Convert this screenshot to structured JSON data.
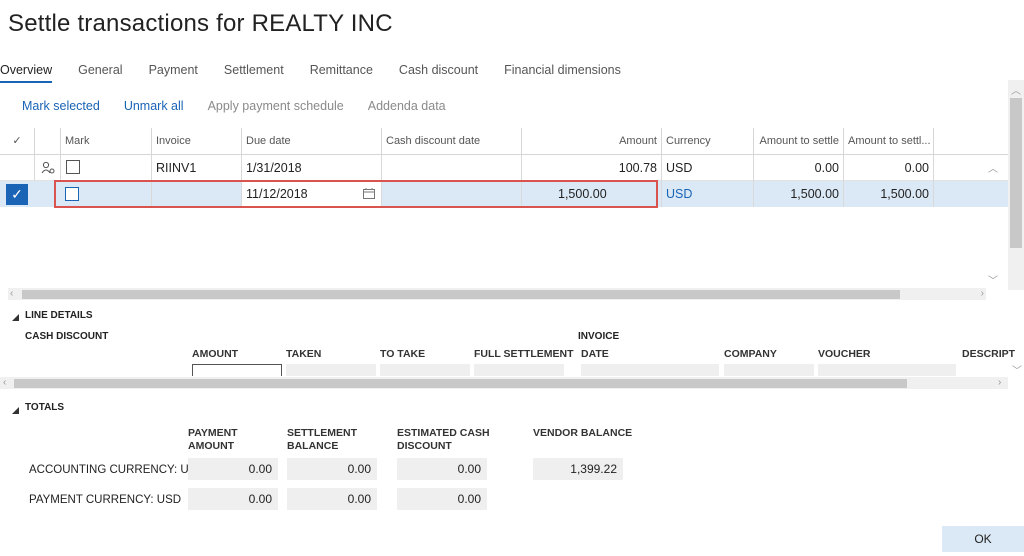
{
  "title": "Settle transactions for REALTY INC",
  "tabs": [
    "Overview",
    "General",
    "Payment",
    "Settlement",
    "Remittance",
    "Cash discount",
    "Financial dimensions"
  ],
  "actions": {
    "mark_selected": "Mark selected",
    "unmark_all": "Unmark all",
    "apply_payment_schedule": "Apply payment schedule",
    "addenda_data": "Addenda data"
  },
  "grid": {
    "columns": {
      "mark": "Mark",
      "invoice": "Invoice",
      "due_date": "Due date",
      "cash_discount_date": "Cash discount date",
      "amount": "Amount",
      "currency": "Currency",
      "amount_to_settle": "Amount to settle",
      "amount_to_settle2": "Amount to settl..."
    },
    "rows": [
      {
        "invoice": "RIINV1",
        "due_date": "1/31/2018",
        "cash_discount_date": "",
        "amount": "100.78",
        "currency": "USD",
        "amount_to_settle": "0.00",
        "amount_to_settle2": "0.00"
      },
      {
        "invoice": "",
        "due_date": "11/12/2018",
        "cash_discount_date": "",
        "amount": "1,500.00",
        "currency": "USD",
        "amount_to_settle": "1,500.00",
        "amount_to_settle2": "1,500.00"
      }
    ]
  },
  "line_details": {
    "section": "LINE DETAILS",
    "cash_discount": "CASH DISCOUNT",
    "invoice": "INVOICE",
    "col_amount": "AMOUNT",
    "col_taken": "TAKEN",
    "col_to_take": "TO TAKE",
    "col_full_settlement": "FULL SETTLEMENT",
    "col_date": "DATE",
    "col_company": "COMPANY",
    "col_voucher": "VOUCHER",
    "col_descript": "DESCRIPT"
  },
  "totals": {
    "section": "TOTALS",
    "col_payment_amount_1": "PAYMENT",
    "col_payment_amount_2": "AMOUNT",
    "col_settlement_balance_1": "SETTLEMENT",
    "col_settlement_balance_2": "BALANCE",
    "col_estimated_cash_discount_1": "ESTIMATED CASH",
    "col_estimated_cash_discount_2": "DISCOUNT",
    "col_vendor_balance": "VENDOR BALANCE",
    "accounting_label": "ACCOUNTING CURRENCY: USD",
    "payment_label": "PAYMENT CURRENCY: USD",
    "accounting_payment_amount": "0.00",
    "accounting_settlement_balance": "0.00",
    "accounting_estimated_cash_discount": "0.00",
    "vendor_balance": "1,399.22",
    "payment_payment_amount": "0.00",
    "payment_settlement_balance": "0.00",
    "payment_estimated_cash_discount": "0.00"
  },
  "ok_label": "OK",
  "colors": {
    "accent": "#1a64b5",
    "selected_row": "#dbe8f6",
    "highlight": "#d9534f"
  }
}
